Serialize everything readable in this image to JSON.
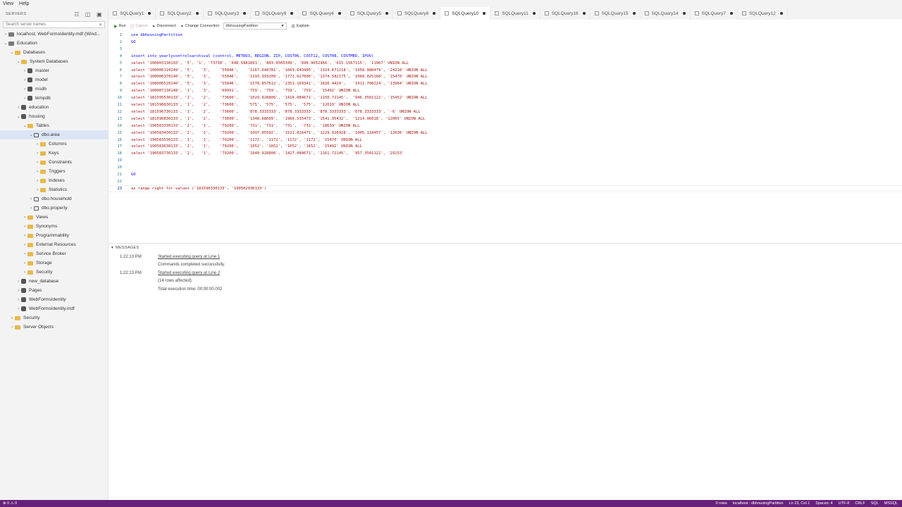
{
  "menu": {
    "view": "View",
    "help": "Help"
  },
  "sidebar": {
    "header": "SERVERS",
    "search_placeholder": "Search server names",
    "tree": [
      {
        "label": "localhost, WebFormsIdentity.mdf (Wind...",
        "depth": 0,
        "tw": "›",
        "icon": "server"
      },
      {
        "label": "Education",
        "depth": 0,
        "tw": "⌄",
        "icon": "server"
      },
      {
        "label": "Databases",
        "depth": 1,
        "tw": "⌄",
        "icon": "folder"
      },
      {
        "label": "System Databases",
        "depth": 2,
        "tw": "⌄",
        "icon": "folder"
      },
      {
        "label": "master",
        "depth": 3,
        "tw": "›",
        "icon": "db"
      },
      {
        "label": "model",
        "depth": 3,
        "tw": "›",
        "icon": "db"
      },
      {
        "label": "msdb",
        "depth": 3,
        "tw": "›",
        "icon": "db"
      },
      {
        "label": "tempdb",
        "depth": 3,
        "tw": "›",
        "icon": "db"
      },
      {
        "label": "education",
        "depth": 2,
        "tw": "›",
        "icon": "db"
      },
      {
        "label": "housing",
        "depth": 2,
        "tw": "⌄",
        "icon": "db"
      },
      {
        "label": "Tables",
        "depth": 3,
        "tw": "⌄",
        "icon": "folder"
      },
      {
        "label": "dbo.area",
        "depth": 4,
        "tw": "⌄",
        "icon": "table",
        "selected": true
      },
      {
        "label": "Columns",
        "depth": 5,
        "tw": "›",
        "icon": "folder"
      },
      {
        "label": "Keys",
        "depth": 5,
        "tw": "›",
        "icon": "folder"
      },
      {
        "label": "Constraints",
        "depth": 5,
        "tw": "›",
        "icon": "folder"
      },
      {
        "label": "Triggers",
        "depth": 5,
        "tw": "›",
        "icon": "folder"
      },
      {
        "label": "Indexes",
        "depth": 5,
        "tw": "›",
        "icon": "folder"
      },
      {
        "label": "Statistics",
        "depth": 5,
        "tw": "›",
        "icon": "folder"
      },
      {
        "label": "dbo.household",
        "depth": 4,
        "tw": "›",
        "icon": "table"
      },
      {
        "label": "dbo.property",
        "depth": 4,
        "tw": "›",
        "icon": "table"
      },
      {
        "label": "Views",
        "depth": 3,
        "tw": "›",
        "icon": "folder"
      },
      {
        "label": "Synonyms",
        "depth": 3,
        "tw": "›",
        "icon": "folder"
      },
      {
        "label": "Programmability",
        "depth": 3,
        "tw": "›",
        "icon": "folder"
      },
      {
        "label": "External Resources",
        "depth": 3,
        "tw": "›",
        "icon": "folder"
      },
      {
        "label": "Service Broker",
        "depth": 3,
        "tw": "›",
        "icon": "folder"
      },
      {
        "label": "Storage",
        "depth": 3,
        "tw": "›",
        "icon": "folder"
      },
      {
        "label": "Security",
        "depth": 3,
        "tw": "›",
        "icon": "folder"
      },
      {
        "label": "new_database",
        "depth": 2,
        "tw": "›",
        "icon": "db"
      },
      {
        "label": "Pages",
        "depth": 2,
        "tw": "›",
        "icon": "db"
      },
      {
        "label": "WebFormsIdentity",
        "depth": 2,
        "tw": "›",
        "icon": "db"
      },
      {
        "label": "WebFormsIdentity.mdf",
        "depth": 2,
        "tw": "›",
        "icon": "db"
      },
      {
        "label": "Security",
        "depth": 1,
        "tw": "›",
        "icon": "folder"
      },
      {
        "label": "Server Objects",
        "depth": 1,
        "tw": "›",
        "icon": "folder"
      }
    ]
  },
  "tabs": [
    {
      "label": "SQLQuery1",
      "active": false
    },
    {
      "label": "SQLQuery2",
      "active": false
    },
    {
      "label": "SQLQuery3",
      "active": false
    },
    {
      "label": "SQLQuery9",
      "active": false
    },
    {
      "label": "SQLQuery4",
      "active": false
    },
    {
      "label": "SQLQuery5",
      "active": false
    },
    {
      "label": "SQLQuery6",
      "active": false
    },
    {
      "label": "SQLQuery10",
      "active": true
    },
    {
      "label": "SQLQuery11",
      "active": false
    },
    {
      "label": "SQLQuery16",
      "active": false
    },
    {
      "label": "SQLQuery15",
      "active": false
    },
    {
      "label": "SQLQuery14",
      "active": false
    },
    {
      "label": "SQLQuery7",
      "active": false
    },
    {
      "label": "SQLQuery12",
      "active": false
    }
  ],
  "toolbar": {
    "run": "Run",
    "cancel": "Cancel",
    "disconnect": "Disconnect",
    "change_connection": "Change Connection",
    "database": "dbhousingPartition",
    "explain": "Explain"
  },
  "editor": {
    "lines": [
      {
        "n": "1",
        "text": "use dbhousingPartition"
      },
      {
        "n": "2",
        "text": "GO"
      },
      {
        "n": "3",
        "text": ""
      },
      {
        "n": "4",
        "text": "insert into yearlycontrolsarchival (control, METRO3, REGION, ZIP, COST06, COST12, COST08, COSTMED, IPOV)"
      },
      {
        "n": "5",
        "text": "select '100003130103', '5', '1', '73738', '648.5881891', '803.0505349', '696.9052466', '615.1567115', '11067' UNION ALL"
      },
      {
        "n": "6",
        "text": "select '100006110249', '5',   '3',    '55846',    '1167.640781', '1669.643405', '1324.671218', '1058.988479', '24218' UNION ALL"
      },
      {
        "n": "7",
        "text": "select '100006370140', '5',   '3',    '55846',    '1193.393209', '1772.627006', '1374.582175', '1068.025168', '15470' UNION ALL"
      },
      {
        "n": "8",
        "text": "select '100006520140', '5',   '3',    '55846',    '1578.857612', '2351.169341', '1820.4429',   '1411.700224', '13964' UNION ALL"
      },
      {
        "n": "9",
        "text": "select '100007130148', '1',   '3',    '60991',    '759', '759',  '759',  '759',  '15492' UNION ALL"
      },
      {
        "n": "10",
        "text": "select '181595530133', '1',   '2',    '73600',    '1029.928806', '1416.084671', '1150.72145',  '946.3501122', '15452' UNION ALL"
      },
      {
        "n": "11",
        "text": "select '181596630133', '1',   '2',    '73600',    '575', '575',  '575',  '575',  '12019' UNION ALL"
      },
      {
        "n": "12",
        "text": "select '181596730133', '1',   '2',    '73600',    '878.3333333', '878.3333333', '878.3333333', '878.3333333', '-6' UNION ALL"
      },
      {
        "n": "13",
        "text": "select '181596830133', '1',   '2',    '73600',    '1348.68609',  '1966.535473', '1541.95432',  '1214.96018', '12005' UNION ALL"
      },
      {
        "n": "14",
        "text": "select '190583330133', '2',   '1',    '79200',    '731', '731',  '731',  '731',  '18639' UNION ALL"
      },
      {
        "n": "15",
        "text": "select '190583430133', '2',   '1',    '79200',    '1097.05502',  '1521.826471', '1229.926928', '1005.118457', '12036' UNION ALL"
      },
      {
        "n": "16",
        "text": "select '190583530133', '3',   '1',    '79200',    '1172', '1172', '1172', '1172', '15470' UNION ALL"
      },
      {
        "n": "17",
        "text": "select '190583630133', '2',   '1',    '79200',    '1652', '1652', '1652', '1652', '15492' UNION ALL"
      },
      {
        "n": "18",
        "text": "select '190583730133', '2',   '1',    '79200',    '1040.928806', '1427.084671', '1161.72145',  '957.3501122', '29153'"
      },
      {
        "n": "19",
        "text": ""
      },
      {
        "n": "20",
        "text": ""
      },
      {
        "n": "21",
        "text": "GO"
      },
      {
        "n": "22",
        "text": ""
      },
      {
        "n": "23",
        "text": "as range right for values ('181596330133', '190502930133')"
      }
    ]
  },
  "messages": {
    "header": "MESSAGES",
    "rows": [
      {
        "time": "1:22:13 PM",
        "text": "Started executing query at Line 1",
        "link": true
      },
      {
        "time": "",
        "text": "Commands completed successfully.",
        "link": false
      },
      {
        "time": "1:22:13 PM",
        "text": "Started executing query at Line 2",
        "link": true
      },
      {
        "time": "",
        "text": "(14 rows affected)",
        "link": false
      },
      {
        "time": "",
        "text": "Total execution time: 00:00:00.002",
        "link": false
      }
    ]
  },
  "status": {
    "left": "⊗ 0 ⚠ 0",
    "items": [
      "0 rows",
      "localhost : dbhousingPartition",
      "Ln 23, Col 1",
      "Spaces: 4",
      "UTF-8",
      "CRLF",
      "SQL",
      "MSSQL"
    ]
  },
  "colors": {
    "statusbar": "#68217a",
    "keyword": "#0000ff",
    "string": "#a31515",
    "line_number": "#237893"
  }
}
